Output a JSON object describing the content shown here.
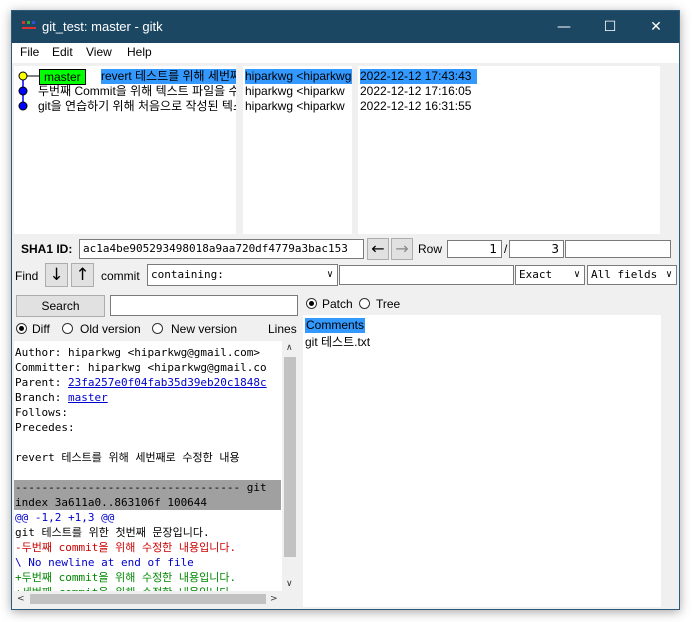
{
  "window": {
    "title": "git_test: master - gitk",
    "minimize": "—",
    "maximize": "☐",
    "close": "✕"
  },
  "menu": [
    "File",
    "Edit",
    "View",
    "Help"
  ],
  "commits": [
    {
      "branch": "master",
      "message": "revert 테스트를 위해 세번째",
      "author": "hiparkwg <hiparkwg",
      "date": "2022-12-12 17:43:43",
      "selected": true
    },
    {
      "branch": "",
      "message": "두번째 Commit을 위해 텍스트 파일을 수",
      "author": "hiparkwg <hiparkw",
      "date": "2022-12-12 17:16:05",
      "selected": false
    },
    {
      "branch": "",
      "message": "git을 연습하기 위해 처음으로 작성된 텍스",
      "author": "hiparkwg <hiparkw",
      "date": "2022-12-12 16:31:55",
      "selected": false
    }
  ],
  "sha": {
    "label": "SHA1 ID:",
    "value": "ac1a4be905293498018a9aa720df4779a3bac153",
    "row_label": "Row",
    "row_current": "1",
    "row_sep": "/",
    "row_total": "3"
  },
  "find": {
    "label": "Find",
    "commit_label": "commit",
    "type_value": "containing:",
    "match_value": "Exact",
    "fields_value": "All fields"
  },
  "search": {
    "button": "Search"
  },
  "view_modes": {
    "diff": "Diff",
    "old": "Old version",
    "new": "New version",
    "lines": "Lines"
  },
  "tree_modes": {
    "patch": "Patch",
    "tree": "Tree"
  },
  "diff_lines": [
    {
      "text": "Author: hiparkwg <hiparkwg@gmail.com>",
      "kind": "plain"
    },
    {
      "text": "Committer: hiparkwg <hiparkwg@gmail.co",
      "kind": "plain"
    },
    {
      "text": "Parent: ",
      "link": "23fa257e0f04fab35d39eb20c1848c",
      "kind": "link"
    },
    {
      "text": "Branch: ",
      "link": "master",
      "kind": "link"
    },
    {
      "text": "Follows:",
      "kind": "plain"
    },
    {
      "text": "Precedes:",
      "kind": "plain"
    },
    {
      "text": "",
      "kind": "plain"
    },
    {
      "text": "    revert 테스트를 위해 세번째로 수정한 내용",
      "kind": "plain"
    },
    {
      "text": "",
      "kind": "plain"
    },
    {
      "text": "---------------------------------- git",
      "kind": "header"
    },
    {
      "text": "index 3a611a0..863106f 100644",
      "kind": "header"
    },
    {
      "text": "@@ -1,2 +1,3 @@",
      "kind": "hunk"
    },
    {
      "text": " git 테스트를 위한 첫번째 문장입니다.",
      "kind": "plain"
    },
    {
      "text": "-두번째 commit을 위해 수정한 내용입니다.",
      "kind": "del"
    },
    {
      "text": "\\ No newline at end of file",
      "kind": "hunk"
    },
    {
      "text": "+두번째 commit을 위해 수정한 내용입니다.",
      "kind": "add"
    },
    {
      "text": "+세번째 commit을 위해 수정한 내용입니다",
      "kind": "add"
    }
  ],
  "files": {
    "header": "Comments",
    "items": [
      "git 테스트.txt"
    ]
  },
  "colors": {
    "titlebar": "#1c4763",
    "selection": "#3399ff",
    "branch_bg": "#00ff00",
    "node_yellow": "#ffff00",
    "node_blue": "#0000ff",
    "del": "#cc0000",
    "add": "#008800",
    "hunk": "#0000cc",
    "header_bg": "#a0a0a0"
  }
}
